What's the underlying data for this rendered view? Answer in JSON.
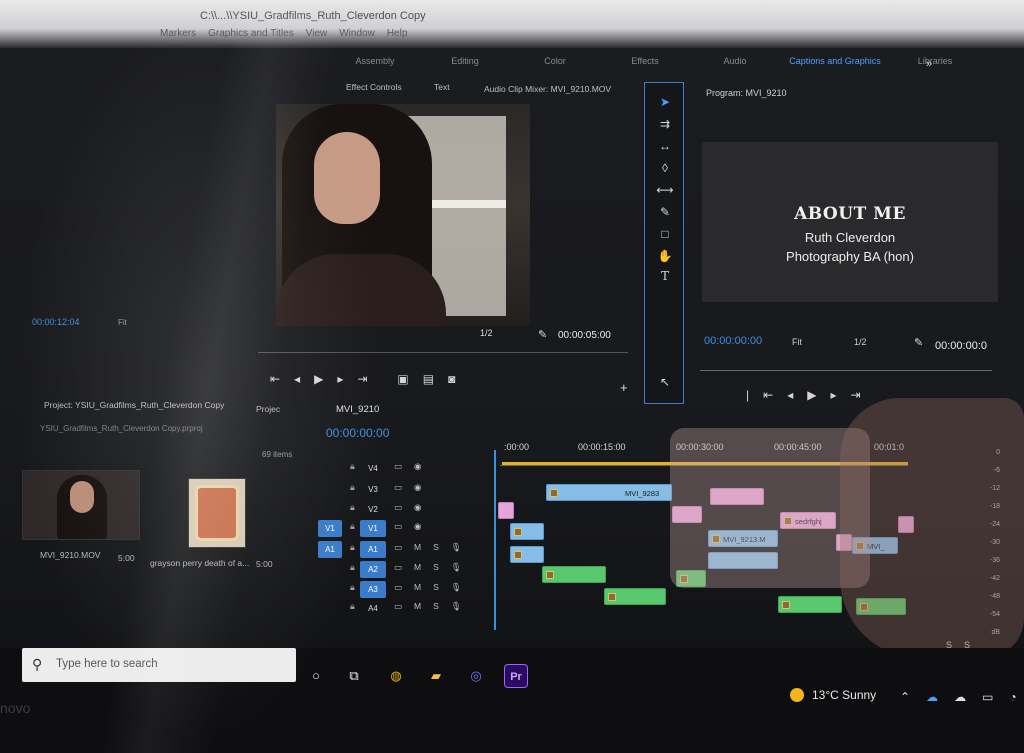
{
  "app": {
    "title": "C:\\\\...\\\\YSIU_Gradfilms_Ruth_Cleverdon Copy",
    "menu": [
      "Markers",
      "Graphics and Titles",
      "View",
      "Window",
      "Help"
    ]
  },
  "workspaces": {
    "tabs": [
      "Assembly",
      "Editing",
      "Color",
      "Effects",
      "Audio",
      "Captions and Graphics",
      "Libraries"
    ],
    "more": "»"
  },
  "source": {
    "tabs": [
      "Effect Controls",
      "Text",
      "Audio Clip Mixer: MVI_9210.MOV"
    ],
    "timecode": "00:00:12:04",
    "fit": "Fit",
    "resolution": "1/2",
    "duration": "00:00:05:00"
  },
  "program": {
    "label": "Program: MVI_9210",
    "title_text": "ABOUT ME",
    "name_text": "Ruth Cleverdon",
    "degree_text": "Photography BA (hon)",
    "timecode": "00:00:00:00",
    "fit": "Fit",
    "resolution": "1/2",
    "duration": "00:00:00:0"
  },
  "project": {
    "title": "Project: YSIU_Gradfilms_Ruth_Cleverdon Copy",
    "tab2": "Projec",
    "file": "YSIU_Gradfilms_Ruth_Cleverdon Copy.prproj",
    "items_count": "69 items",
    "clips": [
      {
        "name": "MVI_9210.MOV",
        "duration": "5:00"
      },
      {
        "name": "grayson perry death of a...",
        "duration": "5:00"
      }
    ]
  },
  "timeline": {
    "tab": "MVI_9210",
    "timecode": "00:00:00:00",
    "ruler": [
      ":00:00",
      "00:00:15:00",
      "00:00:30:00",
      "00:00:45:00",
      "00:01:0"
    ],
    "tracks": [
      {
        "src": "",
        "name": "V4"
      },
      {
        "src": "",
        "name": "V3"
      },
      {
        "src": "",
        "name": "V2"
      },
      {
        "src": "V1",
        "name": "V1"
      },
      {
        "src": "A1",
        "name": "A1"
      },
      {
        "src": "",
        "name": "A2"
      },
      {
        "src": "",
        "name": "A3"
      },
      {
        "src": "",
        "name": "A4"
      }
    ],
    "clip_labels": {
      "mvi9283": "MVI_9283",
      "sedrfghj": "sedrfghj",
      "mvi9213": "MVI_9213.M",
      "mvi_short": "MVI_"
    },
    "meter": [
      "0",
      "-6",
      "-12",
      "-18",
      "-24",
      "-30",
      "-36",
      "-42",
      "-48",
      "-54",
      "dB"
    ],
    "meter_solo": [
      "S",
      "S"
    ]
  },
  "taskbar": {
    "search_placeholder": "Type here to search",
    "weather": "13°C  Sunny",
    "brand": "novo",
    "pr_label": "Pr"
  }
}
